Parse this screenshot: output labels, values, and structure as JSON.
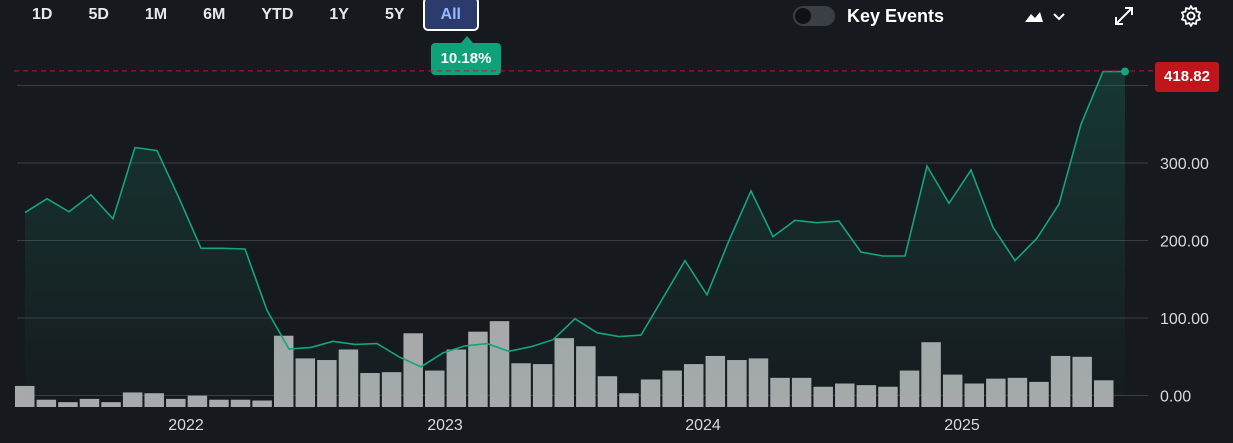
{
  "toolbar": {
    "ranges": [
      "1D",
      "5D",
      "1M",
      "6M",
      "YTD",
      "1Y",
      "5Y",
      "All"
    ],
    "active_range": "All",
    "performance_badge": "10.18%",
    "key_events_label": "Key Events",
    "key_events_enabled": false,
    "icons": [
      "area-chart-icon",
      "chevron-down-icon",
      "expand-icon",
      "gear-icon"
    ]
  },
  "colors": {
    "background": "#16191e",
    "line": "#16a37f",
    "volume": "#a8a9ab",
    "price_marker": "#c0161b",
    "badge": "#0ea27a"
  },
  "current_price_label": "418.82",
  "chart_data": {
    "type": "line",
    "y_axis": {
      "ticks": [
        "0.00",
        "100.00",
        "200.00",
        "300.00",
        "400.00"
      ],
      "range": [
        0,
        430
      ],
      "position": "right"
    },
    "x_axis": {
      "ticks": [
        "2022",
        "2023",
        "2024",
        "2025"
      ]
    },
    "current_price": 418.82,
    "series": [
      {
        "values": [
          236,
          254,
          237,
          259,
          228,
          320,
          316,
          255,
          190,
          190,
          189,
          110,
          60,
          62,
          70,
          66,
          67,
          50,
          37,
          55,
          64,
          67,
          57,
          63,
          72,
          99,
          81,
          76,
          78,
          126,
          174,
          130,
          200,
          264,
          205,
          226,
          223,
          225,
          185,
          180,
          180,
          296,
          248,
          291,
          217,
          174,
          203,
          247,
          350,
          418,
          418
        ]
      }
    ],
    "volume": [
      26,
      9,
      6,
      10,
      6,
      18,
      17,
      10,
      14,
      9,
      9,
      8,
      88,
      60,
      58,
      71,
      42,
      43,
      91,
      45,
      71,
      93,
      106,
      54,
      53,
      85,
      75,
      38,
      17,
      34,
      45,
      53,
      63,
      58,
      60,
      36,
      36,
      25,
      29,
      27,
      25,
      45,
      80,
      40,
      29,
      35,
      36,
      31,
      63,
      62,
      33
    ]
  }
}
